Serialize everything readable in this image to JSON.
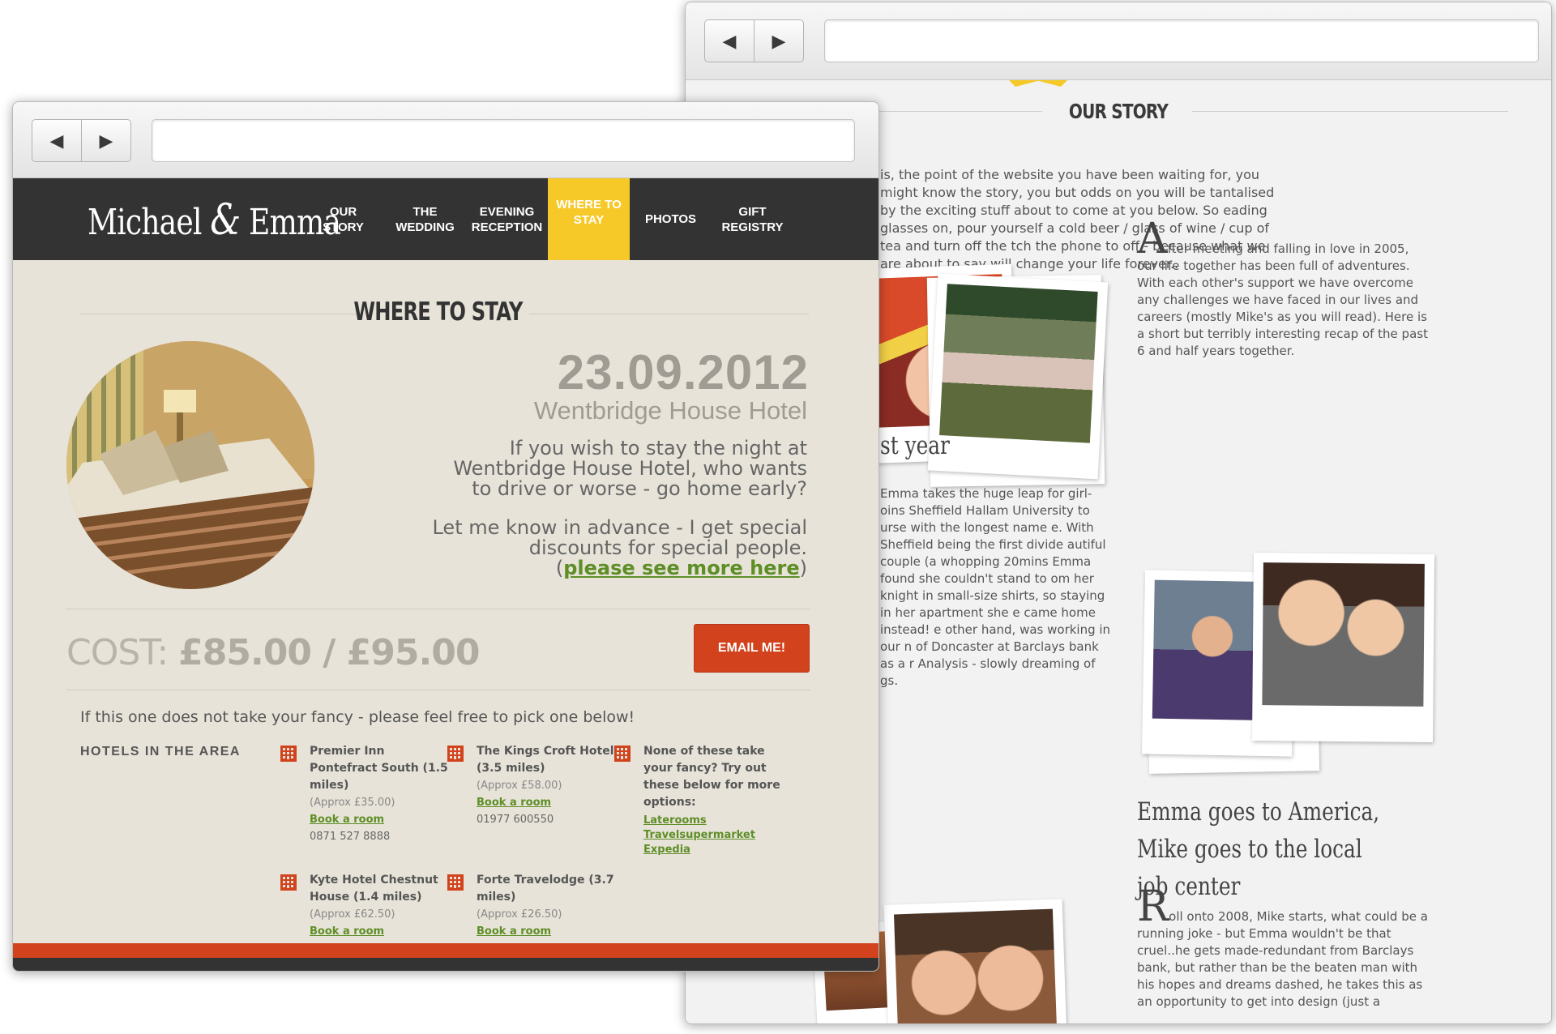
{
  "back_page": {
    "title": "OUR STORY",
    "intro": "is, the point of the website you have been waiting for, you might know the story, you but odds on you will be tantalised by the exciting stuff about to come at you below. So eading glasses on, pour yourself a cold beer / glass of wine / cup of tea and turn off the tch the phone to off - because what we are about to say will change your life forever..",
    "para1_dropcap": "A",
    "para1": "fter meeting and falling in love in 2005, our life together has been full of adventures. With each other's support we have overcome any challenges we have faced in our lives and careers (mostly Mike's as you will read). Here is a short but terribly interesting recap of the past 6 and half years together.",
    "heading_partial": "st year",
    "para_left": "Emma takes the huge leap for girl- oins Sheffield Hallam University to urse with the longest name e. With Sheffield being the first divide autiful couple (a whopping 20mins Emma found she couldn't stand to om her knight in small-size shirts, so staying in her apartment she e came home instead! e other hand, was working in our n of Doncaster at Barclays bank as a r Analysis - slowly dreaming of gs.",
    "heading2": "Emma goes to America, Mike goes to the local job center",
    "para2_dropcap": "R",
    "para2": "oll onto 2008, Mike starts, what could be a running joke - but Emma wouldn't be that cruel..he gets made-redundant from Barclays bank, but rather than be the beaten man with his hopes and dreams dashed, he takes this as an opportunity to get into design (just a"
  },
  "front_page": {
    "logo_first": "Michael",
    "logo_amp": "&",
    "logo_second": "Emma",
    "menu": [
      {
        "label": "OUR\nSTORY",
        "active": false
      },
      {
        "label": "THE\nWEDDING",
        "active": false
      },
      {
        "label": "EVENING\nRECEPTION",
        "active": false
      },
      {
        "label": "WHERE TO\nSTAY",
        "active": true
      },
      {
        "label": "PHOTOS",
        "active": false
      },
      {
        "label": "GIFT\nREGISTRY",
        "active": false
      }
    ],
    "title": "WHERE TO STAY",
    "date": "23.09.2012",
    "venue": "Wentbridge House Hotel",
    "blurb1_line1": "If you wish to stay the night at",
    "blurb1_line2": "Wentbridge House Hotel, who wants",
    "blurb1_line3": "to drive or worse - go home early?",
    "blurb2_line1": "Let me know in advance - I get special",
    "blurb2_line2": "discounts for special people.",
    "blurb2_open": "(",
    "blurb2_link": "please see more here",
    "blurb2_close": ")",
    "cost_label": "COST:",
    "cost_value": "£85.00 / £95.00",
    "email_button": "EMAIL ME!",
    "fancy_text": "If this one does not take your fancy - please feel free to pick one below!",
    "area_heading": "HOTELS IN THE AREA",
    "hotels": [
      {
        "name": "Premier Inn Pontefract South (1.5 miles)",
        "price": "(Approx £35.00)",
        "link": "Book a room",
        "phone": "0871 527 8888"
      },
      {
        "name": "The Kings Croft Hotel (3.5 miles)",
        "price": "(Approx £58.00)",
        "link": "Book a room",
        "phone": "01977 600550"
      },
      {
        "name": "Kyte Hotel Chestnut House (1.4 miles)",
        "price": "(Approx £62.50)",
        "link": "Book a room",
        "phone": ""
      },
      {
        "name": "Forte Travelodge (3.7 miles)",
        "price": "(Approx £26.50)",
        "link": "Book a room",
        "phone": ""
      }
    ],
    "other_options": {
      "text": "None of these take your fancy? Try out these below for more options:",
      "links": [
        "Laterooms",
        "Travelsupermarket",
        "Expedia"
      ]
    }
  },
  "colors": {
    "accent": "#f6c928",
    "button": "#d2421c",
    "link": "#5e8e26",
    "header": "#333333"
  }
}
